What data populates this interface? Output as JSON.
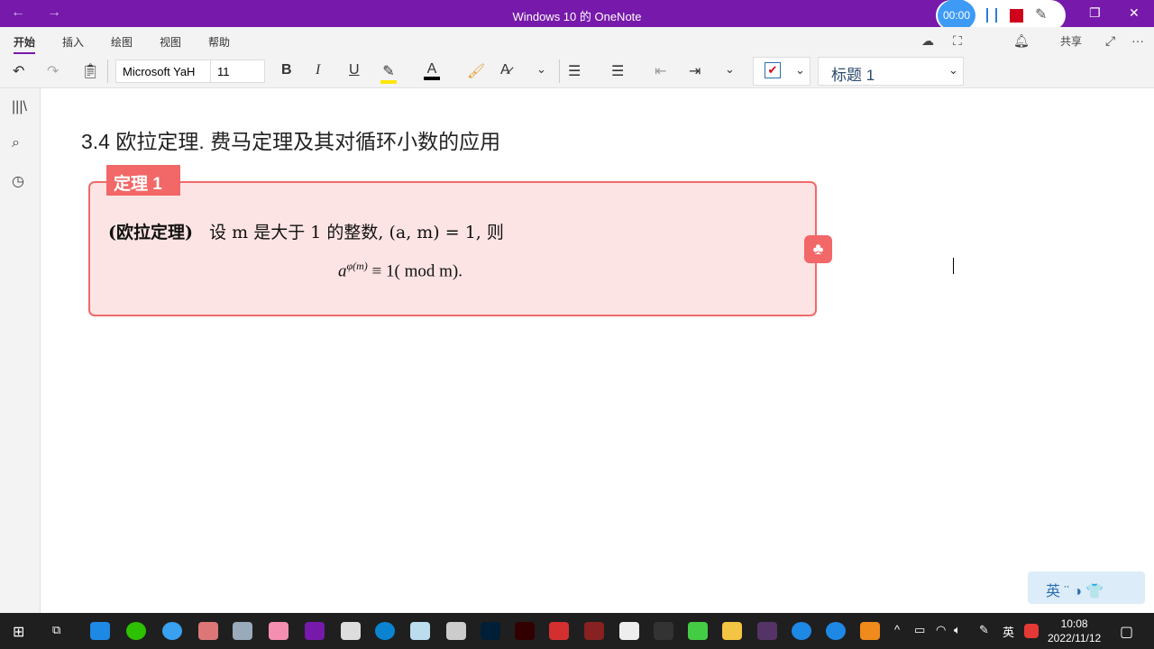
{
  "titlebar": {
    "title": "Windows 10 的 OneNote",
    "back": "←",
    "forward": "→",
    "restore": "❐",
    "close": "✕"
  },
  "recorder": {
    "timer": "00:00"
  },
  "menu": {
    "tabs": [
      "开始",
      "插入",
      "绘图",
      "视图",
      "帮助"
    ],
    "share": "共享",
    "more": "···"
  },
  "toolbar": {
    "font_name": "Microsoft YaH",
    "font_size": "11",
    "bold": "B",
    "italic": "I",
    "underline": "U",
    "font_color": "A",
    "style": "标题 1",
    "chevron": "⌄"
  },
  "colors": {
    "accent": "#7719aa",
    "theorem_border": "#f06a6a",
    "theorem_bg": "#fde4e4"
  },
  "page": {
    "heading": "3.4 欧拉定理. 费马定理及其对循环小数的应用",
    "theorem_label": "定理 1",
    "theorem_name": "(欧拉定理)",
    "statement": "设 m 是大于 1 的整数, (a, m) = 1, 则",
    "formula_base": "a",
    "formula_exp": "φ(m)",
    "formula_rest": " ≡ 1(  mod m)."
  },
  "ime": {
    "label": "英 ¨ ◑ 👕"
  },
  "taskbar": {
    "time": "10:08",
    "date": "2022/11/12",
    "lang": "英"
  }
}
